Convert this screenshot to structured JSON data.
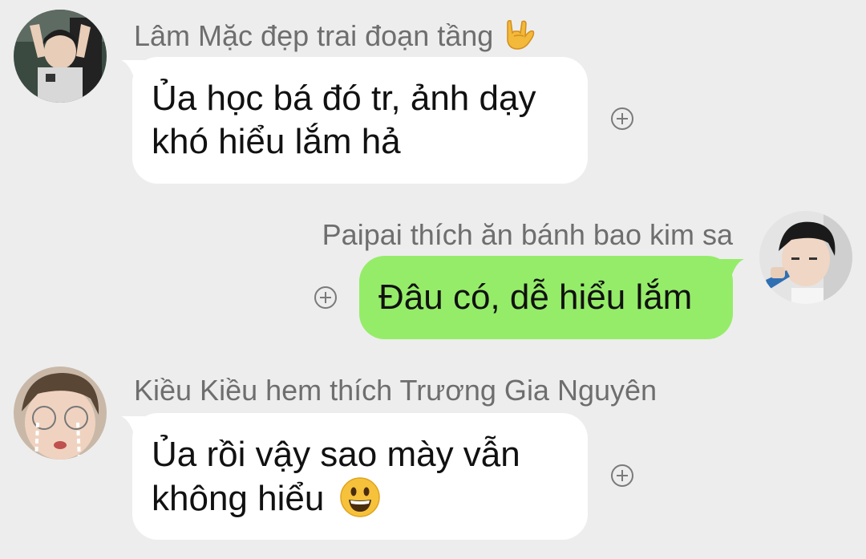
{
  "messages": [
    {
      "sender": "Lâm Mặc đẹp trai đoạn tầng",
      "sender_emoji": "rock-on-hand",
      "lines": [
        "Ủa học bá đó tr, ảnh dạy",
        "khó hiểu lắm hả"
      ],
      "direction": "incoming",
      "avatar": "avatar-boy-hands-up"
    },
    {
      "sender": "Paipai thích ăn bánh bao kim sa",
      "lines": [
        "Đâu có, dễ hiểu lắm"
      ],
      "direction": "outgoing",
      "avatar": "avatar-boy-drinking"
    },
    {
      "sender": "Kiều Kiều hem thích Trương Gia Nguyên",
      "lines": [
        "Ủa rồi vậy sao mày vẫn",
        "không hiểu"
      ],
      "trailing_emoji": "grinning-face",
      "direction": "incoming",
      "avatar": "avatar-crying-boy"
    }
  ],
  "colors": {
    "background": "#ededed",
    "incoming_bubble": "#ffffff",
    "outgoing_bubble": "#95ec69",
    "sender_text": "#6e6e6e",
    "plus_icon": "#7a7a7a"
  }
}
